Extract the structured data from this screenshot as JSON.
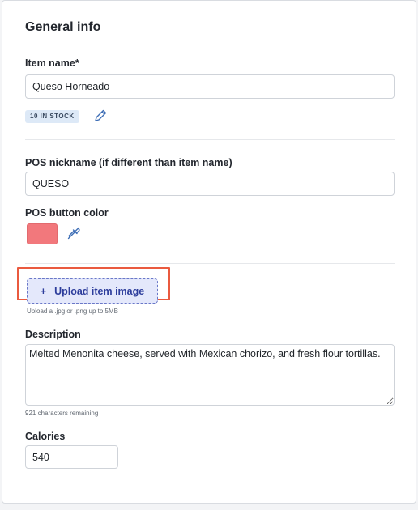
{
  "section": {
    "title": "General info"
  },
  "item_name": {
    "label": "Item name*",
    "value": "Queso Horneado"
  },
  "stock_badge": {
    "text": "10 IN STOCK",
    "edit_icon": "pencil-icon"
  },
  "pos_nickname": {
    "label": "POS nickname (if different than item name)",
    "value": "QUESO"
  },
  "pos_button_color": {
    "label": "POS button color",
    "color": "#f2787c",
    "picker_icon": "eyedropper-icon"
  },
  "upload": {
    "plus": "+",
    "label": "Upload item image",
    "hint": "Upload a .jpg or .png up to 5MB"
  },
  "description": {
    "label": "Description",
    "value": "Melted Menonita cheese, served with Mexican chorizo, and fresh flour tortillas.",
    "remaining": "921 characters remaining"
  },
  "calories": {
    "label": "Calories",
    "value": "540"
  },
  "colors": {
    "highlight": "#ea5a3f",
    "upload_bg": "#e4e8fb",
    "upload_text": "#2e3e9c",
    "badge_bg": "#dde9f7"
  }
}
